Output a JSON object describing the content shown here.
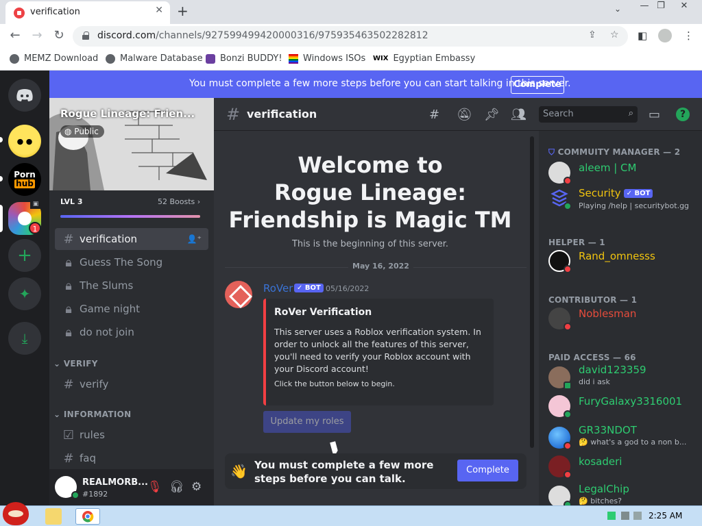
{
  "browser": {
    "tab_title": "verification",
    "url_host": "discord.com",
    "url_path": "/channels/927599499420000316/975935463502282812",
    "bookmarks": [
      "MEMZ Download",
      "Malware Database",
      "Bonzi BUDDY!",
      "Windows ISOs",
      "Egyptian Embassy"
    ]
  },
  "banner": {
    "text": "You must complete a few more steps before you can start talking in this server.",
    "button": "Complete"
  },
  "server": {
    "name": "Rogue Lineage: Frien...",
    "visibility": "Public",
    "level": "LVL 3",
    "boosts": "52 Boosts",
    "boost_progress": 1.0,
    "unread_badge": "1",
    "channels": [
      {
        "icon": "hash",
        "label": "verification"
      },
      {
        "icon": "lock",
        "label": "Guess The Song"
      },
      {
        "icon": "lock",
        "label": "The Slums"
      },
      {
        "icon": "lock",
        "label": "Game night"
      },
      {
        "icon": "lock",
        "label": "do not join"
      }
    ],
    "categories": {
      "verify": "VERIFY",
      "information": "INFORMATION"
    },
    "verify_channels": [
      "verify"
    ],
    "info_channels": [
      "rules",
      "faq"
    ]
  },
  "user": {
    "name": "REALMORB...",
    "tag": "#1892"
  },
  "chat": {
    "channel": "verification",
    "search_placeholder": "Search",
    "welcome_line1": "Welcome to",
    "welcome_line2": "Rogue Lineage:",
    "welcome_line3": "Friendship is Magic TM",
    "beginning": "This is the beginning of this server.",
    "date_divider": "May 16, 2022",
    "message": {
      "author": "RoVer",
      "bot_tag": "✓ BOT",
      "timestamp": "05/16/2022",
      "embed_title": "RoVer Verification",
      "embed_desc": "This server uses a Roblox verification system. In order to unlock all the features of this server, you'll need to verify your Roblox account with your Discord account!",
      "embed_sub": "Click the button below to begin.",
      "button": "Update my roles"
    },
    "composer": {
      "line1": "You must complete a few more",
      "line2": "steps before you can talk.",
      "button": "Complete"
    }
  },
  "members": {
    "groups": [
      {
        "title": "COMMUITY MANAGER — 2"
      },
      {
        "title": "HELPER — 1"
      },
      {
        "title": "CONTRIBUTOR — 1"
      },
      {
        "title": "PAID ACCESS — 66"
      }
    ],
    "list": [
      {
        "name": "aleem | CM",
        "color": "#2ecc71",
        "sub": "",
        "status": "#f23f43"
      },
      {
        "name": "Security",
        "color": "#f1c40f",
        "sub": "Playing /help | securitybot.gg",
        "status": "#23a55a",
        "bot": "✓ BOT"
      },
      {
        "name": "Rand_omnesss",
        "color": "#f1c40f",
        "sub": "",
        "status": "#f23f43"
      },
      {
        "name": "Noblesman",
        "color": "#e74c3c",
        "sub": "",
        "status": "#f23f43"
      },
      {
        "name": "david123359",
        "color": "#2ecc71",
        "sub": "did i ask",
        "status": "#23a55a"
      },
      {
        "name": "FuryGalaxy3316001",
        "color": "#2ecc71",
        "sub": "",
        "status": "#23a55a"
      },
      {
        "name": "GR33NDOT",
        "color": "#2ecc71",
        "sub": "🤔 what's a god to a non b...",
        "status": "#f23f43"
      },
      {
        "name": "kosaderi",
        "color": "#2ecc71",
        "sub": "",
        "status": "#f23f43"
      },
      {
        "name": "LegalChip",
        "color": "#2ecc71",
        "sub": "🤔 bitches?",
        "status": "#23a55a"
      }
    ]
  },
  "taskbar": {
    "clock": "2:25 AM"
  },
  "colors": {
    "blurple": "#5865f2",
    "online": "#23a55a",
    "dnd": "#f23f43"
  }
}
